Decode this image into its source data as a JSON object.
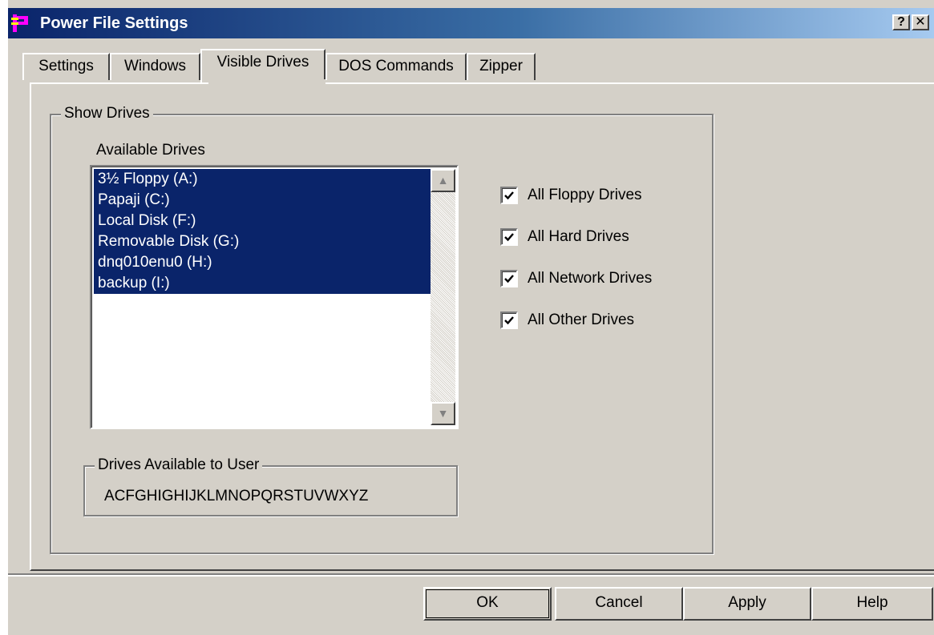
{
  "window": {
    "title": "Power File Settings",
    "help_label": "?",
    "close_label": "✕"
  },
  "tabs": [
    {
      "label": "Settings"
    },
    {
      "label": "Windows"
    },
    {
      "label": "Visible Drives",
      "active": true
    },
    {
      "label": "DOS Commands"
    },
    {
      "label": "Zipper"
    }
  ],
  "show_drives": {
    "legend": "Show Drives",
    "available_label": "Available Drives",
    "drives": [
      "3½ Floppy (A:)",
      "Papaji (C:)",
      "Local Disk (F:)",
      "Removable Disk (G:)",
      "dnq010enu0 (H:)",
      "backup (I:)"
    ],
    "checkboxes": [
      {
        "label": "All Floppy Drives",
        "checked": true
      },
      {
        "label": "All Hard Drives",
        "checked": true
      },
      {
        "label": "All Network Drives",
        "checked": true
      },
      {
        "label": "All Other Drives",
        "checked": true
      }
    ],
    "user_drives_legend": "Drives Available to User",
    "user_drives_value": "ACFGHIGHIJKLMNOPQRSTUVWXYZ"
  },
  "buttons": {
    "ok": "OK",
    "cancel": "Cancel",
    "apply": "Apply",
    "help": "Help"
  },
  "colors": {
    "title_start": "#0a246a",
    "selection": "#0a246a",
    "face": "#d4d0c8"
  }
}
